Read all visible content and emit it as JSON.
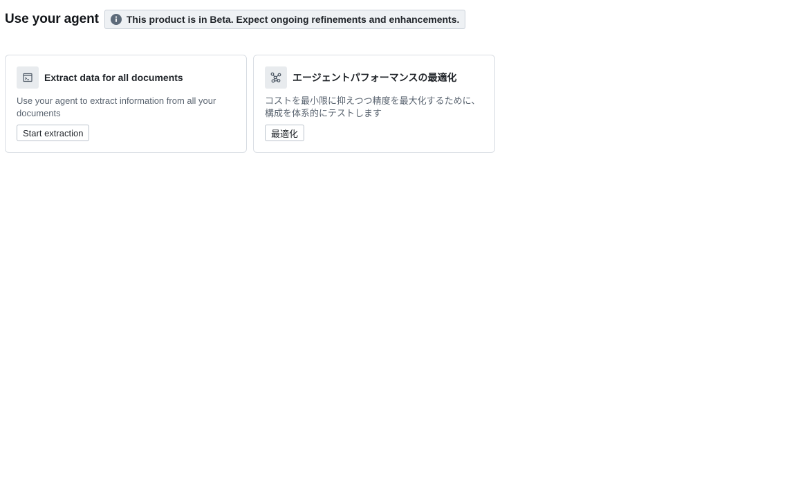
{
  "header": {
    "title": "Use your agent",
    "beta_notice": "This product is in Beta. Expect ongoing refinements and enhancements.",
    "info_icon": "info-icon"
  },
  "cards": [
    {
      "icon": "terminal-window-icon",
      "title": "Extract data for all documents",
      "description": "Use your agent to extract information from all your documents",
      "button_label": "Start extraction"
    },
    {
      "icon": "graph-nodes-icon",
      "title": "エージェントパフォーマンスの最適化",
      "description": "コストを最小限に抑えつつ精度を最大化するために、構成を体系的にテストします",
      "button_label": "最適化"
    }
  ],
  "colors": {
    "badge_background": "#eef1f4",
    "badge_border": "#c9d0d8",
    "icon_tile": "#e8ebee",
    "muted_text": "#5a6470"
  }
}
